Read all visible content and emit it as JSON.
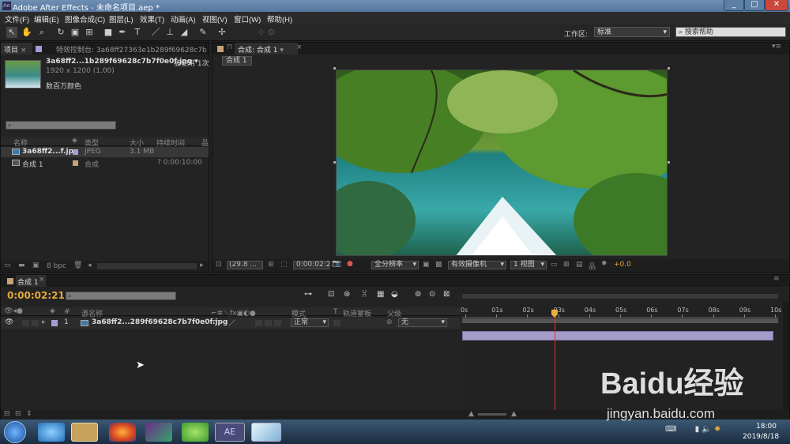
{
  "window": {
    "title": "Adobe After Effects - 未命名项目.aep *",
    "app_icon": "Ae"
  },
  "menu": [
    "文件(F)",
    "编辑(E)",
    "图像合成(C)",
    "图层(L)",
    "效果(T)",
    "动画(A)",
    "视图(V)",
    "窗口(W)",
    "帮助(H)"
  ],
  "toolbar": {
    "workspace_label": "工作区:",
    "workspace_value": "标准",
    "search_placeholder": "搜索帮助"
  },
  "project_panel": {
    "tab_project": "项目",
    "tab_effects": "特效控制台: 3a68ff27363e1b289f69628c7b",
    "file_name": "3a68ff2...1b289f69628c7b7f0e0f.jpg ▾",
    "used_label": "被使用 1次",
    "file_info": "1920 x 1200 (1.00)",
    "color_info": "数百万颜色",
    "columns": [
      "名称",
      "类型",
      "大小",
      "持续时间"
    ],
    "items": [
      {
        "name": "3a68ff2...f.jpg",
        "type": "JPEG",
        "size": "3.1 MB",
        "duration": ""
      },
      {
        "name": "合成 1",
        "type": "合成",
        "size": "",
        "duration": "? 0:00:10:00"
      }
    ],
    "bpc": "8 bpc"
  },
  "comp_panel": {
    "tab": "合成: 合成 1",
    "sub_tab": "合成 1",
    "zoom": "(29.8 ...",
    "timecode": "0:00:02:21",
    "resolution": "全分辨率",
    "camera": "有效摄像机",
    "views": "1 视图",
    "exposure": "+0.0"
  },
  "timeline": {
    "tab": "合成 1",
    "timecode": "0:00:02:21",
    "columns": {
      "source": "源名称",
      "mode": "模式",
      "trk": "T",
      "track_matte": "轨道蒙板",
      "parent": "父级"
    },
    "layer": {
      "index": "1",
      "name": "3a68ff2...289f69628c7b7f0e0f.jpg",
      "mode": "正常",
      "parent": "无"
    },
    "ruler": [
      "0s",
      "01s",
      "02s",
      "03s",
      "04s",
      "05s",
      "06s",
      "07s",
      "08s",
      "09s",
      "10s"
    ],
    "playhead_seconds": 2.88
  },
  "taskbar": {
    "time": "18:00",
    "date": "2019/8/18",
    "ae_label": "AE"
  },
  "watermark": {
    "brand": "Baidu经验",
    "url": "jingyan.baidu.com"
  },
  "colors": {
    "accent_orange": "#e8a33a",
    "layer_bar": "#a59bc8",
    "playhead": "#e03030",
    "timecode": "#e5a83a"
  }
}
